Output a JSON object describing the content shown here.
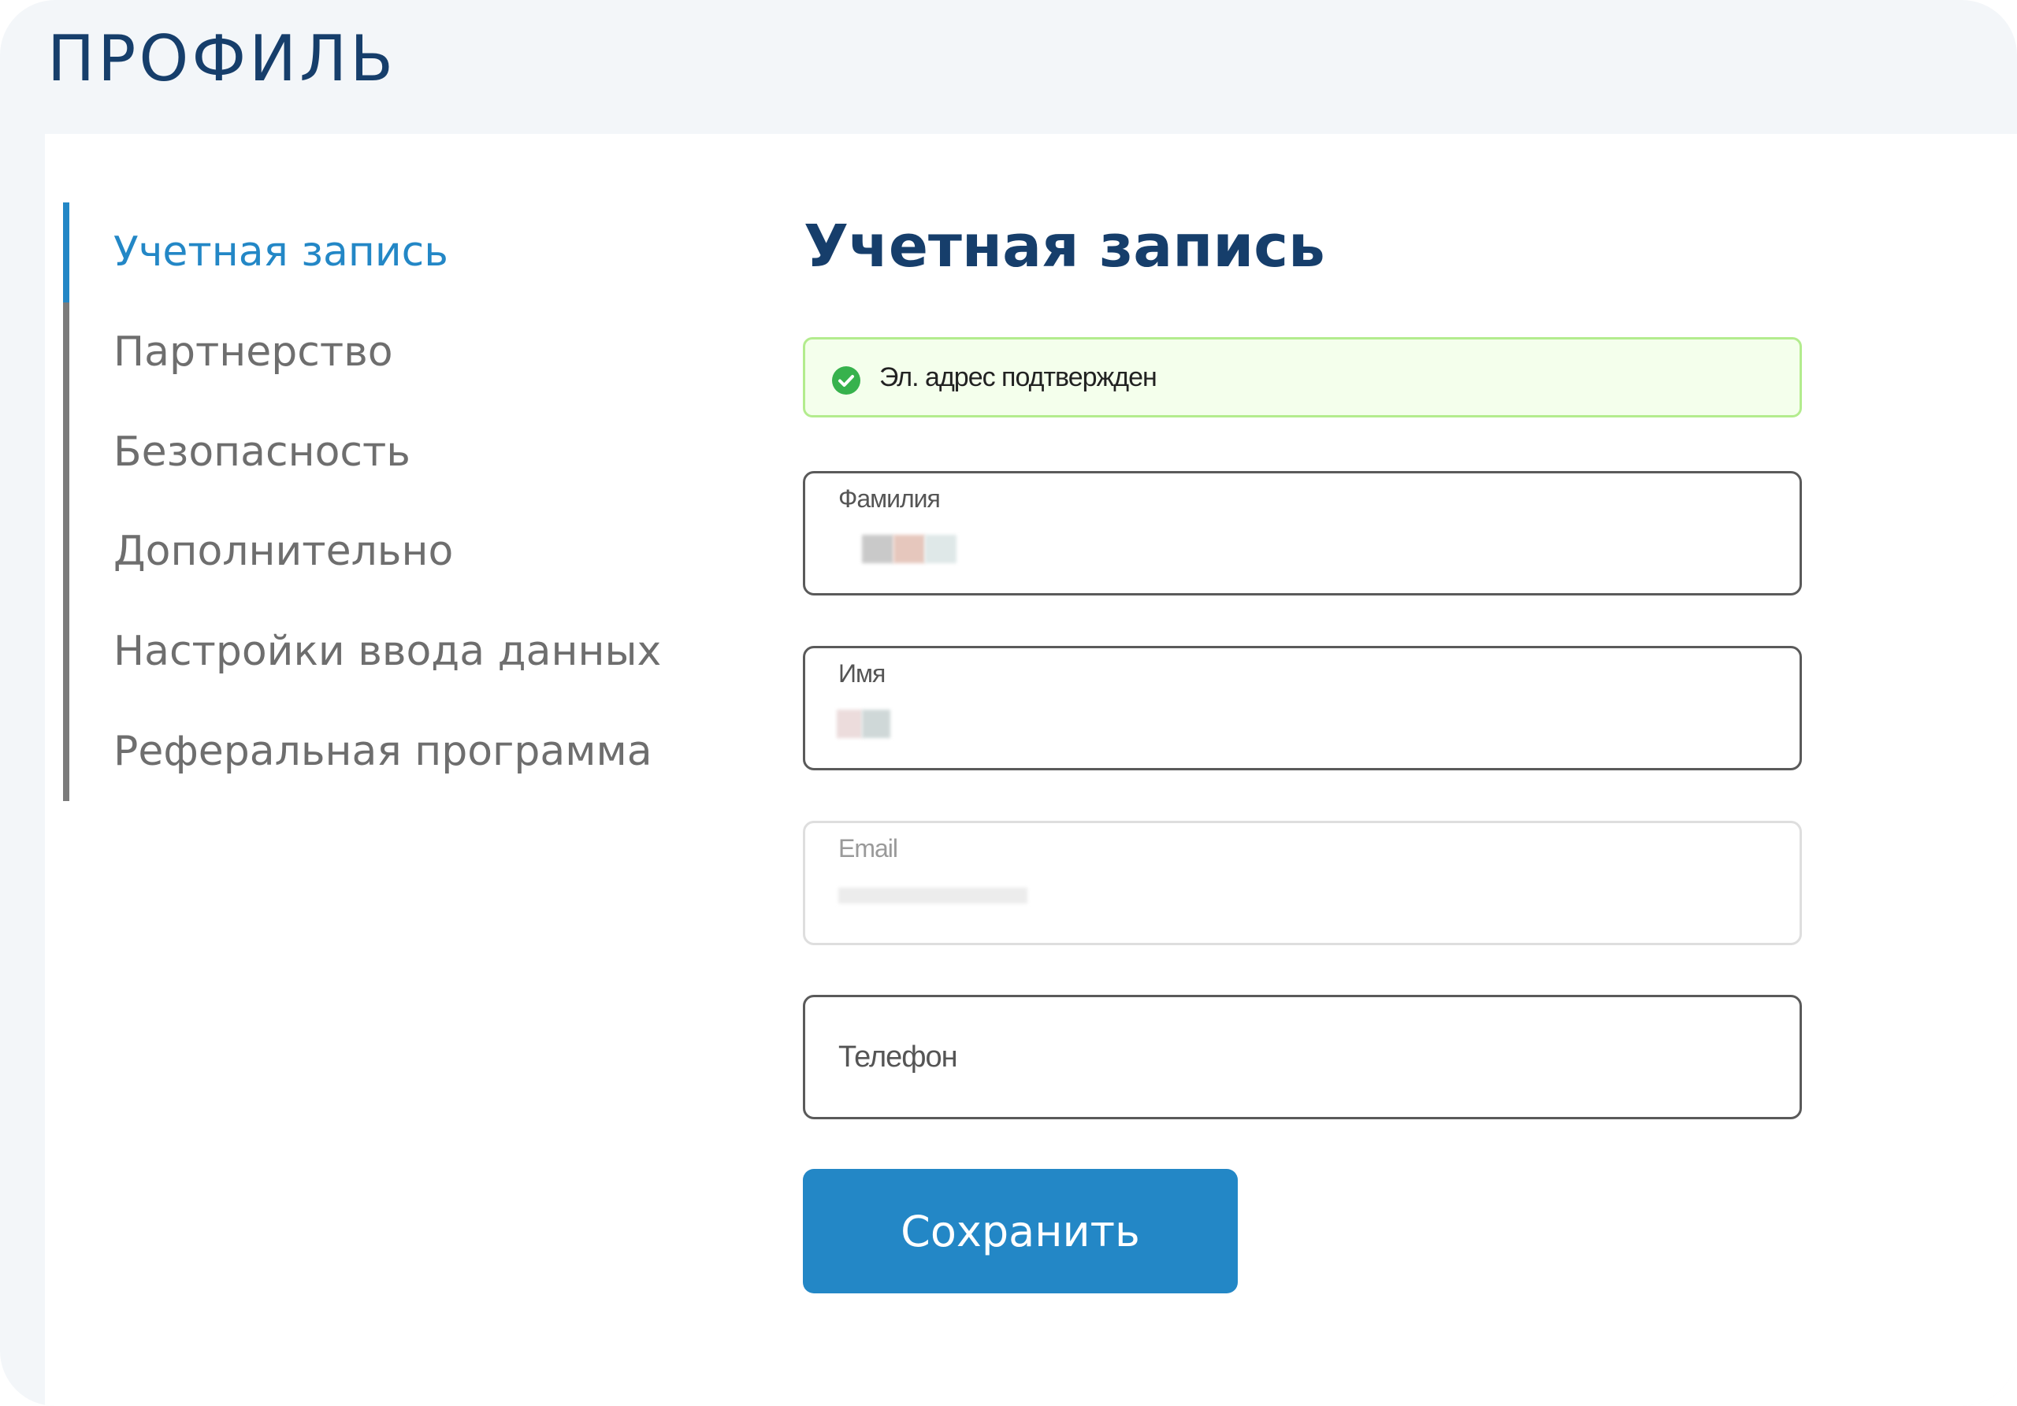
{
  "page": {
    "title": "ПРОФИЛЬ"
  },
  "sidebar": {
    "items": [
      {
        "label": "Учетная запись",
        "active": true
      },
      {
        "label": "Партнерство",
        "active": false
      },
      {
        "label": "Безопасность",
        "active": false
      },
      {
        "label": "Дополнительно",
        "active": false
      },
      {
        "label": "Настройки ввода данных",
        "active": false
      },
      {
        "label": "Реферальная программа",
        "active": false
      }
    ]
  },
  "main": {
    "section_title": "Учетная запись",
    "alert": {
      "icon": "check-circle-icon",
      "text": "Эл. адрес подтвержден"
    },
    "fields": {
      "last_name": {
        "label": "Фамилия",
        "value": ""
      },
      "first_name": {
        "label": "Имя",
        "value": ""
      },
      "email": {
        "label": "Email",
        "value": "",
        "disabled": true
      },
      "phone": {
        "label": "Телефон",
        "value": ""
      }
    },
    "save_label": "Сохранить"
  },
  "colors": {
    "accent": "#2387c6",
    "title": "#163e6b",
    "success": "#37b24d",
    "alert_bg": "#f4ffec",
    "alert_border": "#b3ec8e"
  }
}
